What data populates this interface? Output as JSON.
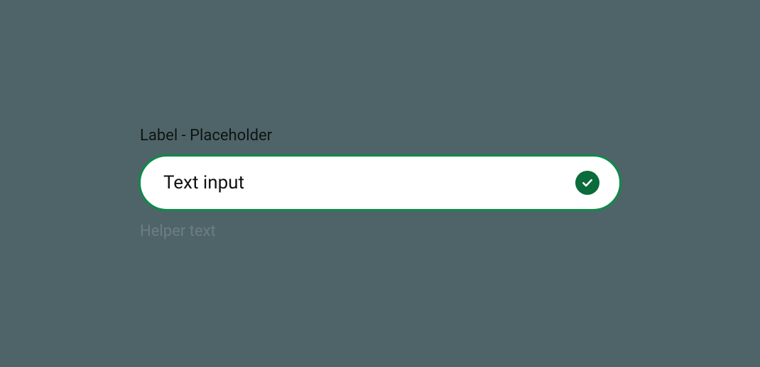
{
  "field": {
    "label": "Label - Placeholder",
    "value": "Text input",
    "helper": "Helper text",
    "status_icon": "check-icon",
    "colors": {
      "background": "#4f6469",
      "border": "#0d8b49",
      "badge": "#0b6b3a",
      "input_bg": "#ffffff",
      "helper_text": "#6b7f82"
    }
  }
}
